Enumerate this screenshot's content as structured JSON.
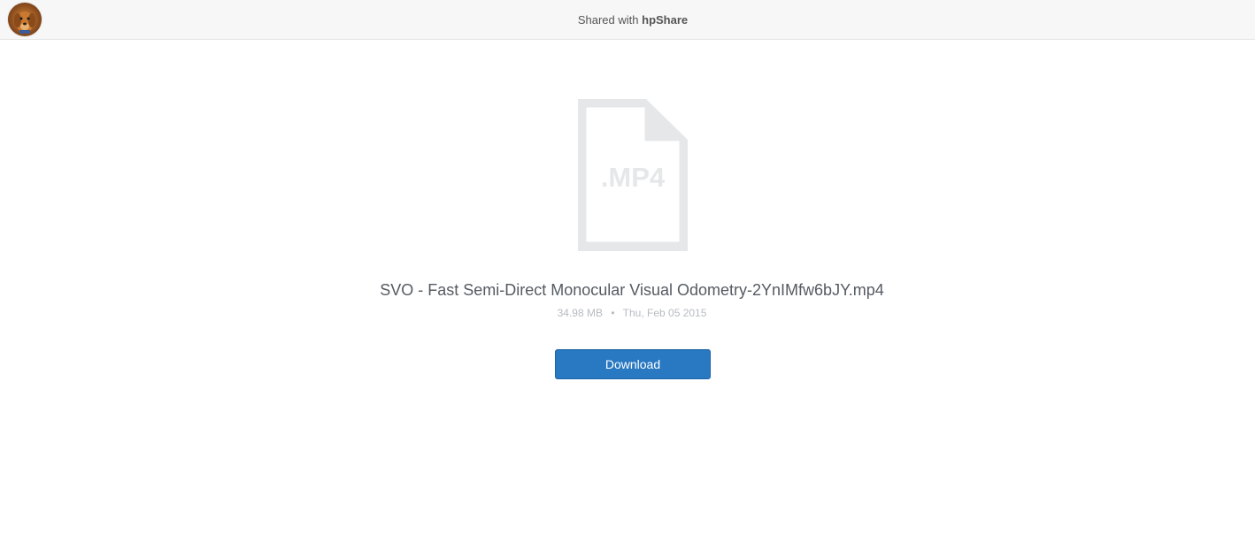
{
  "header": {
    "shared_prefix": "Shared with",
    "brand": "hpShare",
    "avatar_icon": "avatar-dog-photo"
  },
  "file": {
    "icon": "file-document-icon",
    "extension_label": ".MP4",
    "name": "SVO - Fast Semi-Direct Monocular Visual Odometry-2YnIMfw6bJY.mp4",
    "size": "34.98 MB",
    "separator": "•",
    "date": "Thu, Feb 05 2015"
  },
  "actions": {
    "download_label": "Download"
  },
  "colors": {
    "accent": "#2878c2",
    "header_bg": "#f7f7f7",
    "icon_gray": "#e6e7e8"
  }
}
